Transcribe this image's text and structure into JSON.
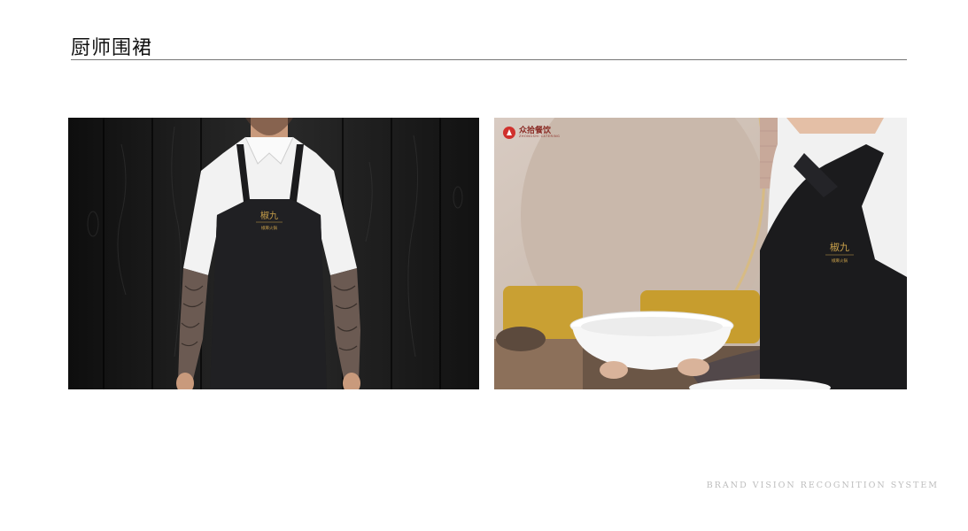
{
  "page": {
    "title": "厨师围裙",
    "footer": "BRAND VISION RECOGNITION SYSTEM"
  },
  "apron_logo": {
    "name": "椒九",
    "tagline": "椒麻火锅"
  },
  "photo_right": {
    "brand_mark": {
      "name_cn": "众拾餐饮",
      "name_en": "ZHONGSHI CATERING"
    }
  },
  "colors": {
    "logo_gold": "#c9a04a",
    "rule": "#777777",
    "footer_text": "#bdbdbd",
    "brand_red": "#d0312d"
  }
}
